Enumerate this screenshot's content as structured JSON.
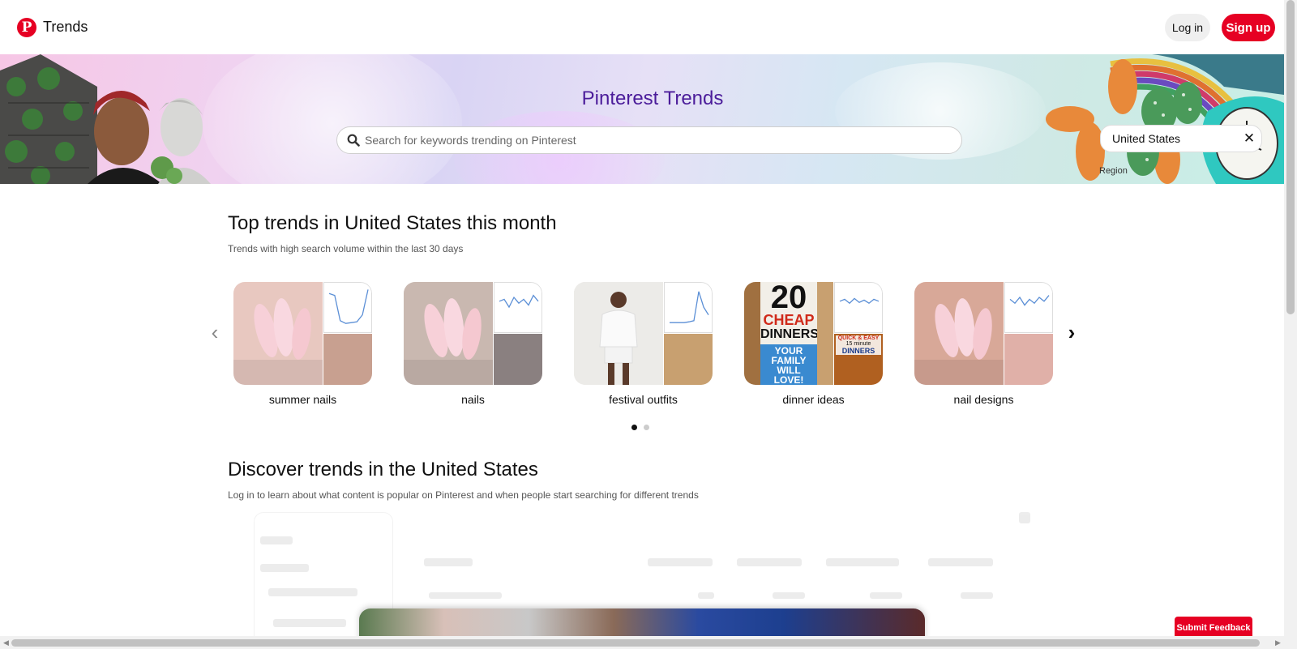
{
  "header": {
    "brand": "Trends",
    "login_label": "Log in",
    "signup_label": "Sign up"
  },
  "hero": {
    "title": "Pinterest Trends",
    "search_placeholder": "Search for keywords trending on Pinterest",
    "region_label": "Region",
    "region_value": "United States"
  },
  "top_trends": {
    "title": "Top trends in United States this month",
    "subtitle": "Trends with high search volume within the last 30 days",
    "cards": [
      {
        "label": "summer nails",
        "main_color": "#e8c8c0",
        "side_color": "#c8a090",
        "trend": [
          0.15,
          0.2,
          0.85,
          0.92,
          0.9,
          0.88,
          0.7,
          0.05
        ]
      },
      {
        "label": "nails",
        "main_color": "#c9b8b0",
        "side_color": "#8a8080",
        "trend": [
          0.35,
          0.3,
          0.5,
          0.25,
          0.4,
          0.3,
          0.45,
          0.2,
          0.35
        ]
      },
      {
        "label": "festival outfits",
        "main_color": "#e8e4e0",
        "side_color": "#c8a070",
        "trend": [
          0.9,
          0.9,
          0.9,
          0.9,
          0.88,
          0.85,
          0.1,
          0.5,
          0.7
        ]
      },
      {
        "label": "dinner ideas",
        "main_color": "#d0a060",
        "side_color": "#b06020",
        "trend": [
          0.35,
          0.3,
          0.4,
          0.28,
          0.38,
          0.32,
          0.4,
          0.3,
          0.35
        ]
      },
      {
        "label": "nail designs",
        "main_color": "#d8a898",
        "side_color": "#e0b0a8",
        "trend": [
          0.3,
          0.4,
          0.25,
          0.45,
          0.3,
          0.4,
          0.25,
          0.35,
          0.2
        ]
      }
    ],
    "card_title_text": "20",
    "card_title_text2": "CHEAP",
    "card_title_text3": "DINNERS",
    "card_sub_text": "YOUR",
    "card_sub_text2": "FAMILY",
    "card_sub_text3": "WILL",
    "card_sub_text4": "LOVE!",
    "side_text": "QUICK & EASY",
    "side_text2": "15 minute",
    "side_text3": "DINNERS"
  },
  "discover": {
    "title": "Discover trends in the United States",
    "subtitle": "Log in to learn about what content is popular on Pinterest and when people start searching for different trends"
  },
  "feedback_label": "Submit Feedback",
  "colors": {
    "accent": "#e60023",
    "hero_title": "#4b1c9a",
    "trend_line": "#5b8fd6"
  }
}
